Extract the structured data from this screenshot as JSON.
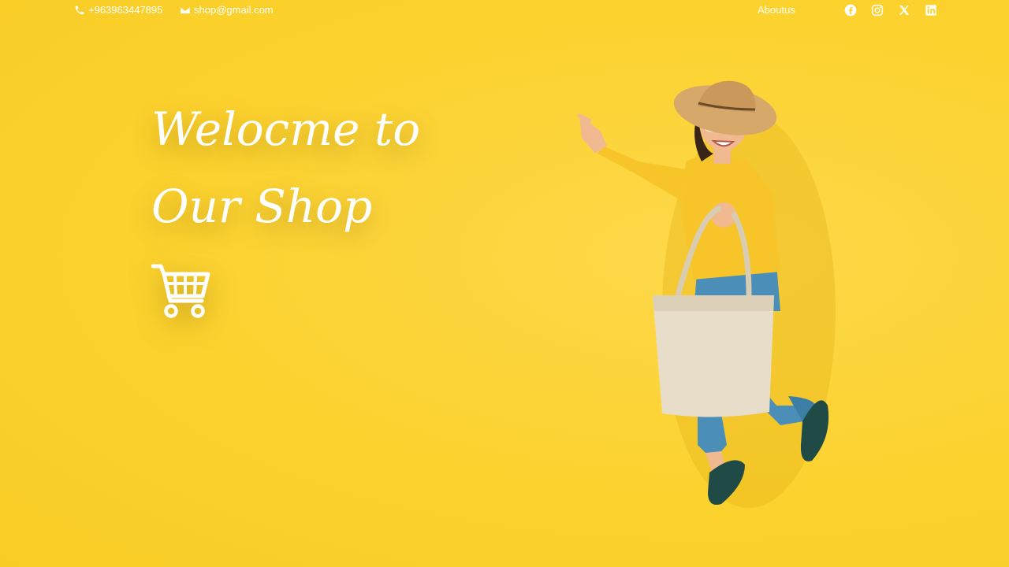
{
  "header": {
    "phone": "+963963447895",
    "email": "shop@gmail.com",
    "about_label": "Aboutus",
    "socials": [
      {
        "name": "facebook-icon"
      },
      {
        "name": "instagram-icon"
      },
      {
        "name": "x-icon"
      },
      {
        "name": "linkedin-icon"
      }
    ]
  },
  "hero": {
    "line1": "Welocme to",
    "line2": "Our Shop",
    "cart_icon": "shopping-cart-icon"
  },
  "colors": {
    "background": "#fcd22e",
    "text": "#ffffff",
    "sweater": "#f7c52a",
    "bag": "#e7ddc8"
  }
}
